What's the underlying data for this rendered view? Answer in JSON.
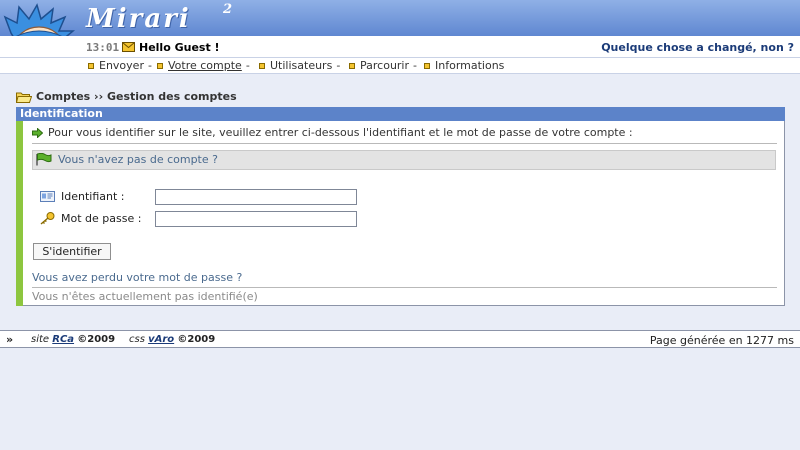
{
  "header": {
    "logo_text": "Mirari",
    "logo_sup": "2",
    "clock": "13:01",
    "greeting": "Hello Guest !",
    "tagline": "Quelque chose a changé, non ?"
  },
  "nav": [
    {
      "label": "Envoyer",
      "sep": "-"
    },
    {
      "label": "Votre compte",
      "sep": "-"
    },
    {
      "label": "Utilisateurs",
      "sep": "-"
    },
    {
      "label": "Parcourir",
      "sep": "-"
    },
    {
      "label": "Informations",
      "sep": ""
    }
  ],
  "breadcrumb": "Comptes ›› Gestion des comptes",
  "panel": {
    "title": "Identification",
    "intro": "Pour vous identifier sur le site, veuillez entrer ci-dessous l'identifiant et le mot de passe de votre compte :",
    "no_account": "Vous n'avez pas de compte ?",
    "username_label": "Identifiant :",
    "username_value": "",
    "password_label": "Mot de passe :",
    "password_value": "",
    "submit_label": "S'identifier",
    "lost_password": "Vous avez perdu votre mot de passe ?",
    "status": "Vous n'êtes actuellement pas identifié(e)"
  },
  "footer": {
    "arrows": "»",
    "site_prefix": "site",
    "site_author": "RCa",
    "site_year": "©2009",
    "css_prefix": "css",
    "css_author": "vAro",
    "css_year": "©2009",
    "generated": "Page générée en 1277 ms"
  },
  "colors": {
    "header_top": "#8fb0e6",
    "header_bottom": "#5f87d1",
    "panel_title_bg": "#5c83c9",
    "accent_green": "#8dc63f",
    "link_blue": "#1b3b78",
    "page_bg": "#e9edf7"
  }
}
